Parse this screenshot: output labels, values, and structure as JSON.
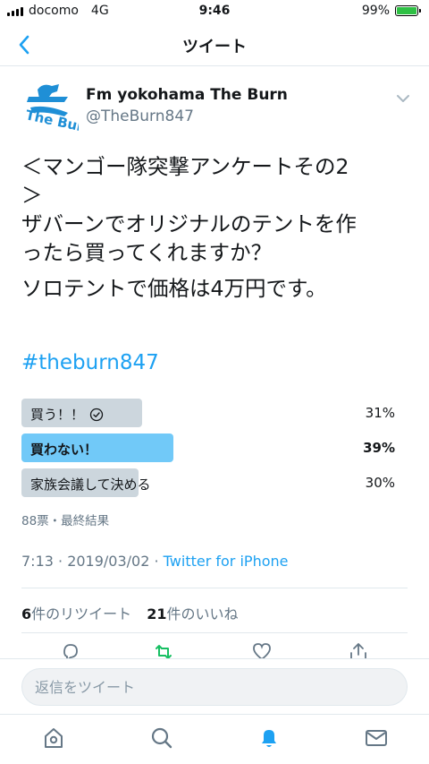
{
  "status_bar": {
    "carrier": "docomo",
    "network": "4G",
    "time": "9:46",
    "battery": "99%",
    "battery_level": 0.99
  },
  "nav": {
    "title": "ツイート"
  },
  "author": {
    "name": "Fm yokohama The Burn",
    "handle": "@TheBurn847",
    "avatar_text": "The Burn"
  },
  "tweet": {
    "lines": [
      "＜マンゴー隊突撃アンケートその2",
      "＞",
      "ザバーンでオリジナルのテントを作",
      "ったら買ってくれますか？"
    ],
    "line2": "ソロテントで価格は4万円です。",
    "hashtag": "#theburn847"
  },
  "poll": {
    "options": [
      {
        "label": "買う！！",
        "percent": "31%",
        "value": 31,
        "voted": true,
        "winner": false
      },
      {
        "label": "買わない！",
        "percent": "39%",
        "value": 39,
        "voted": false,
        "winner": true
      },
      {
        "label": "家族会議して決める",
        "percent": "30%",
        "value": 30,
        "voted": false,
        "winner": false
      }
    ],
    "meta": "88票・最終結果"
  },
  "timestamp": {
    "time": "7:13 · 2019/03/02 · ",
    "source": "Twitter for iPhone"
  },
  "stats": {
    "retweets_count": "6",
    "retweets_label": "件のリツイート",
    "likes_count": "21",
    "likes_label": "件のいいね"
  },
  "reply": {
    "placeholder": "返信をツイート"
  },
  "colors": {
    "accent": "#1da1f2",
    "poll_win": "#71c9f8",
    "poll_bar": "#ccd6dd",
    "battery": "#2ec044"
  },
  "tabs": [
    "home-icon",
    "search-icon",
    "notifications-icon",
    "messages-icon"
  ]
}
